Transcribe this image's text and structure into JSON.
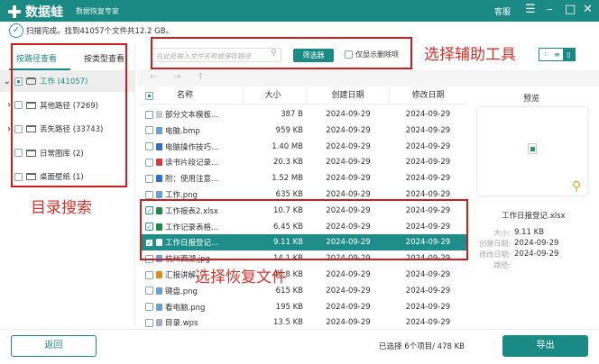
{
  "header": {
    "app_name": "数据蛙",
    "subtitle": "数据恢复专家",
    "support": "客服",
    "menu_icon": "☰",
    "minimize": "–",
    "maximize": "□",
    "close": "✕",
    "color": "#1b8a84"
  },
  "status": {
    "text": "扫描完成。找到41057个文件共12.2 GB。"
  },
  "left": {
    "tabs": [
      "按路径查看",
      "按类型查看"
    ],
    "tree": [
      {
        "label": "工作 (41057)",
        "expand": "⌄",
        "root": true
      },
      {
        "label": "其他路径 (7269)",
        "expand": "›"
      },
      {
        "label": "丢失路径 (33743)",
        "expand": "›"
      },
      {
        "label": "日常图库 (2)",
        "expand": ""
      },
      {
        "label": "桌面壁纸 (1)",
        "expand": ""
      }
    ]
  },
  "toolbar": {
    "search_placeholder": "在此处输入文件名称或保存路径",
    "filter": "筛选器",
    "only_deleted": "仅显示删除项"
  },
  "nav": {
    "back": "←",
    "forward": "→",
    "up": "↑"
  },
  "table": {
    "headers": [
      "名称",
      "大小",
      "创建日期",
      "修改日期"
    ],
    "rows": [
      {
        "name": "部分文本模板...",
        "size": "387  B",
        "created": "2024-09-29",
        "modified": "2024-09-29",
        "icon": "#ccc",
        "checked": false
      },
      {
        "name": "电脑.bmp",
        "size": "959 KB",
        "created": "2024-09-29",
        "modified": "2024-09-29",
        "icon": "#6a9fd8",
        "checked": false
      },
      {
        "name": "电脑操作技巧...",
        "size": "1.40 MB",
        "created": "2024-09-29",
        "modified": "2024-09-29",
        "icon": "#2f6fd0",
        "checked": false
      },
      {
        "name": "读书片段记录...",
        "size": "20.3 KB",
        "created": "2024-09-29",
        "modified": "2024-09-29",
        "icon": "#d83a3a",
        "checked": false
      },
      {
        "name": "附：使用注意...",
        "size": "1.52 MB",
        "created": "2024-09-29",
        "modified": "2024-09-29",
        "icon": "#2f6fd0",
        "checked": false
      },
      {
        "name": "工作.png",
        "size": "635 KB",
        "created": "2024-09-29",
        "modified": "2024-09-29",
        "icon": "#6a9fd8",
        "checked": false
      },
      {
        "name": "工作报表2.xlsx",
        "size": "10.7 KB",
        "created": "2024-09-29",
        "modified": "2024-09-29",
        "icon": "#1f8a4a",
        "checked": true
      },
      {
        "name": "工作记录表格...",
        "size": "6.45 KB",
        "created": "2024-09-29",
        "modified": "2024-09-29",
        "icon": "#1f8a4a",
        "checked": true
      },
      {
        "name": "工作日报登记...",
        "size": "9.11 KB",
        "created": "2024-09-29",
        "modified": "2024-09-29",
        "icon": "#ffffff",
        "checked": true,
        "selected": true
      },
      {
        "name": "杭州西湖.jpg",
        "size": "14.1 KB",
        "created": "2024-09-29",
        "modified": "2024-09-29",
        "icon": "#6a9fd8",
        "checked": false
      },
      {
        "name": "汇报讲解...",
        "size": "44.8 KB",
        "created": "2024-09-29",
        "modified": "2024-09-29",
        "icon": "#e08a20",
        "checked": false
      },
      {
        "name": "键盘.png",
        "size": "615 KB",
        "created": "2024-09-29",
        "modified": "2024-09-29",
        "icon": "#6a9fd8",
        "checked": false
      },
      {
        "name": "看电脑.png",
        "size": "195 KB",
        "created": "2024-09-29",
        "modified": "2024-09-29",
        "icon": "#6a9fd8",
        "checked": false
      },
      {
        "name": "目录.wps",
        "size": "13.5 KB",
        "created": "2024-09-29",
        "modified": "2024-09-29",
        "icon": "#aac",
        "checked": false
      }
    ]
  },
  "preview": {
    "title": "预览",
    "filename": "工作日报登记.xlsx",
    "fields": [
      {
        "key": "大小:",
        "value": "9.11 KB"
      },
      {
        "key": "创建日期:",
        "value": "2024-09-29"
      },
      {
        "key": "修改日期:",
        "value": "2024-09-29"
      },
      {
        "key": "路径:",
        "value": ""
      }
    ]
  },
  "footer": {
    "back": "返回",
    "summary": "已选择 6个项目/ 478 KB",
    "export": "导出"
  },
  "annotations": {
    "dir_search": "目录搜索",
    "aux_tools": "选择辅助工具",
    "select_files": "选择恢复文件"
  }
}
